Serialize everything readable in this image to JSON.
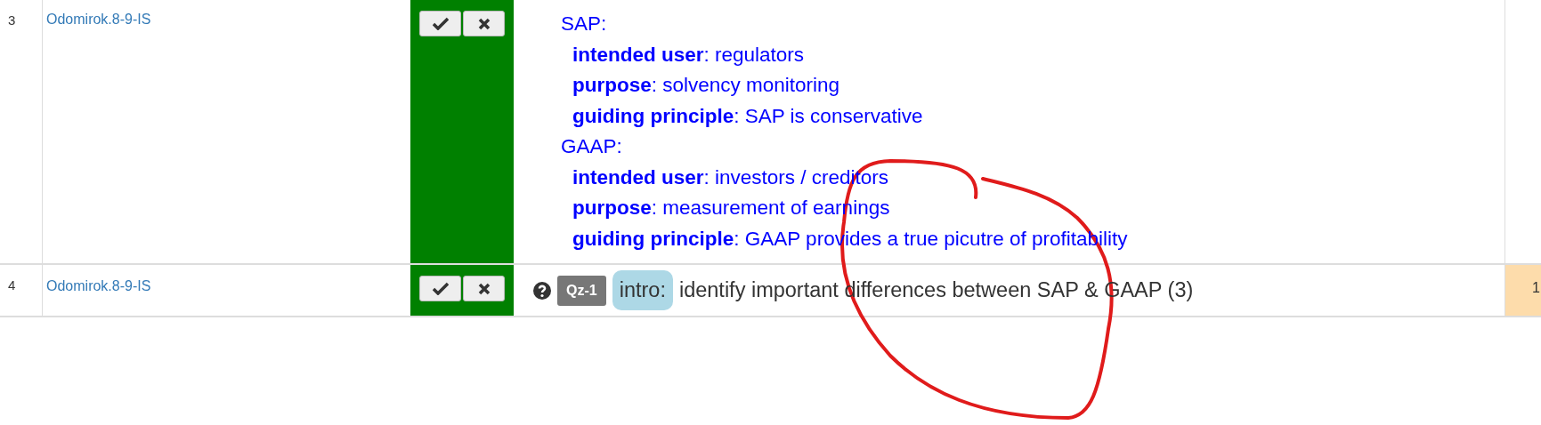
{
  "rows": [
    {
      "number": "3",
      "link": "Odomirok.8-9-IS",
      "color": "#008000",
      "content": {
        "kind": "outline",
        "lines": [
          {
            "kind": "heading",
            "text": "SAP:"
          },
          {
            "kind": "item",
            "text": "**intended user**: regulators"
          },
          {
            "kind": "item",
            "text": "**purpose**: solvency monitoring"
          },
          {
            "kind": "item",
            "text": "**guiding principle**: SAP is conservative"
          },
          {
            "kind": "heading",
            "text": "GAAP:"
          },
          {
            "kind": "item",
            "text": "**intended user**: investors / creditors"
          },
          {
            "kind": "item",
            "text": "**purpose**: measurement of earnings"
          },
          {
            "kind": "item",
            "text": "**guiding principle**: GAAP provides a true picutre of profitability"
          }
        ]
      }
    },
    {
      "number": "4",
      "link": "Odomirok.8-9-IS",
      "color": "#008000",
      "content": {
        "kind": "question",
        "badge": "Qz-1",
        "tag": "intro:",
        "text": "identify important differences between SAP & GAAP (3)"
      },
      "column_5": {
        "text": "1",
        "color": "#fddcab"
      }
    }
  ]
}
